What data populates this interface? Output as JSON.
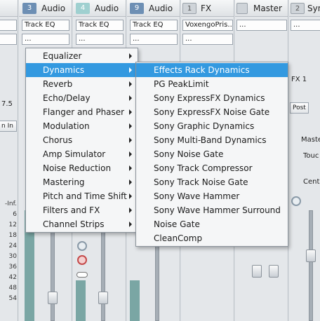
{
  "strips": [
    {
      "num": "",
      "name": "",
      "insert": "",
      "fx": ""
    },
    {
      "num": "3",
      "name": "Audio",
      "insert": "Track EQ",
      "fx": "..."
    },
    {
      "num": "4",
      "name": "Audio",
      "insert": "Track EQ",
      "fx": "..."
    },
    {
      "num": "9",
      "name": "Audio",
      "insert": "Track EQ",
      "fx": "..."
    },
    {
      "num": "1",
      "name": "FX",
      "insert": "VoxengoPris...",
      "fx": "..."
    },
    {
      "num": "",
      "name": "Master",
      "insert": "...",
      "fx": ""
    },
    {
      "num": "2",
      "name": "Syn",
      "insert": "...",
      "fx": ""
    }
  ],
  "left_partial": {
    "value": "7.5",
    "button": "n In"
  },
  "right_partial": {
    "fx_label": "FX 1",
    "post_label": "Post",
    "master_label": "Maste",
    "touch_label": "Touc",
    "center_label": "Cente"
  },
  "meter_scale": [
    "-Inf.",
    "6",
    "12",
    "18",
    "24",
    "30",
    "36",
    "42",
    "48",
    "54"
  ],
  "menu": {
    "items": [
      {
        "label": "Equalizer",
        "submenu": true
      },
      {
        "label": "Dynamics",
        "submenu": true,
        "highlighted": true
      },
      {
        "label": "Reverb",
        "submenu": true
      },
      {
        "label": "Echo/Delay",
        "submenu": true
      },
      {
        "label": "Flanger and Phaser",
        "submenu": true
      },
      {
        "label": "Modulation",
        "submenu": true
      },
      {
        "label": "Chorus",
        "submenu": true
      },
      {
        "label": "Amp Simulator",
        "submenu": true
      },
      {
        "label": "Noise Reduction",
        "submenu": true
      },
      {
        "label": "Mastering",
        "submenu": true
      },
      {
        "label": "Pitch and Time Shift",
        "submenu": true
      },
      {
        "label": "Filters and FX",
        "submenu": true
      },
      {
        "label": "Channel Strips",
        "submenu": true
      }
    ]
  },
  "submenu": {
    "items": [
      {
        "label": "Effects Rack Dynamics",
        "highlighted": true
      },
      {
        "label": "PG PeakLimit"
      },
      {
        "label": "Sony ExpressFX Dynamics"
      },
      {
        "label": "Sony ExpressFX Noise Gate"
      },
      {
        "label": "Sony Graphic Dynamics"
      },
      {
        "label": "Sony Multi-Band Dynamics"
      },
      {
        "label": "Sony Noise Gate"
      },
      {
        "label": "Sony Track Compressor"
      },
      {
        "label": "Sony Track Noise Gate"
      },
      {
        "label": "Sony Wave Hammer"
      },
      {
        "label": "Sony Wave Hammer Surround"
      },
      {
        "label": "Noise Gate"
      },
      {
        "label": "CleanComp"
      }
    ]
  },
  "colors": {
    "highlight": "#3399e0",
    "meter": "#7aa6a4",
    "strip_number": "#6d8fb4"
  }
}
